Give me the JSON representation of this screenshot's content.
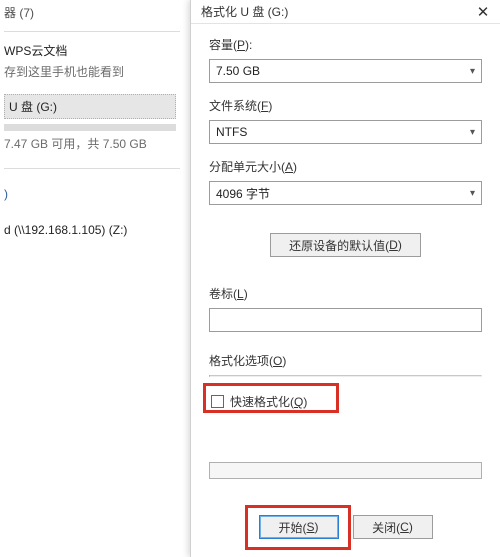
{
  "left": {
    "header": "器 (7)",
    "paren": ")",
    "wps": {
      "name": "WPS云文档",
      "sub": "存到这里手机也能看到"
    },
    "udrive": {
      "name": "U 盘 (G:)",
      "free": "7.47 GB 可用，共 7.50 GB"
    },
    "netdrive": "d (\\\\192.168.1.105) (Z:)"
  },
  "dialog": {
    "title": "格式化 U 盘 (G:)",
    "close": "✕",
    "capacity_label": "容量(",
    "capacity_mn": "P",
    "capacity_value": "7.50 GB",
    "fs_label": "文件系统(",
    "fs_mn": "F",
    "fs_value": "NTFS",
    "aus_label": "分配单元大小(",
    "aus_mn": "A",
    "aus_value": "4096 字节",
    "restore_label": "还原设备的默认值(",
    "restore_mn": "D",
    "vol_label": "卷标(",
    "vol_mn": "L",
    "opts_label": "格式化选项(",
    "opts_mn": "O",
    "quick_label": "快速格式化(",
    "quick_mn": "Q",
    "start_label": "开始(",
    "start_mn": "S",
    "close_label": "关闭(",
    "close_mn": "C",
    "close_paren": ")"
  }
}
